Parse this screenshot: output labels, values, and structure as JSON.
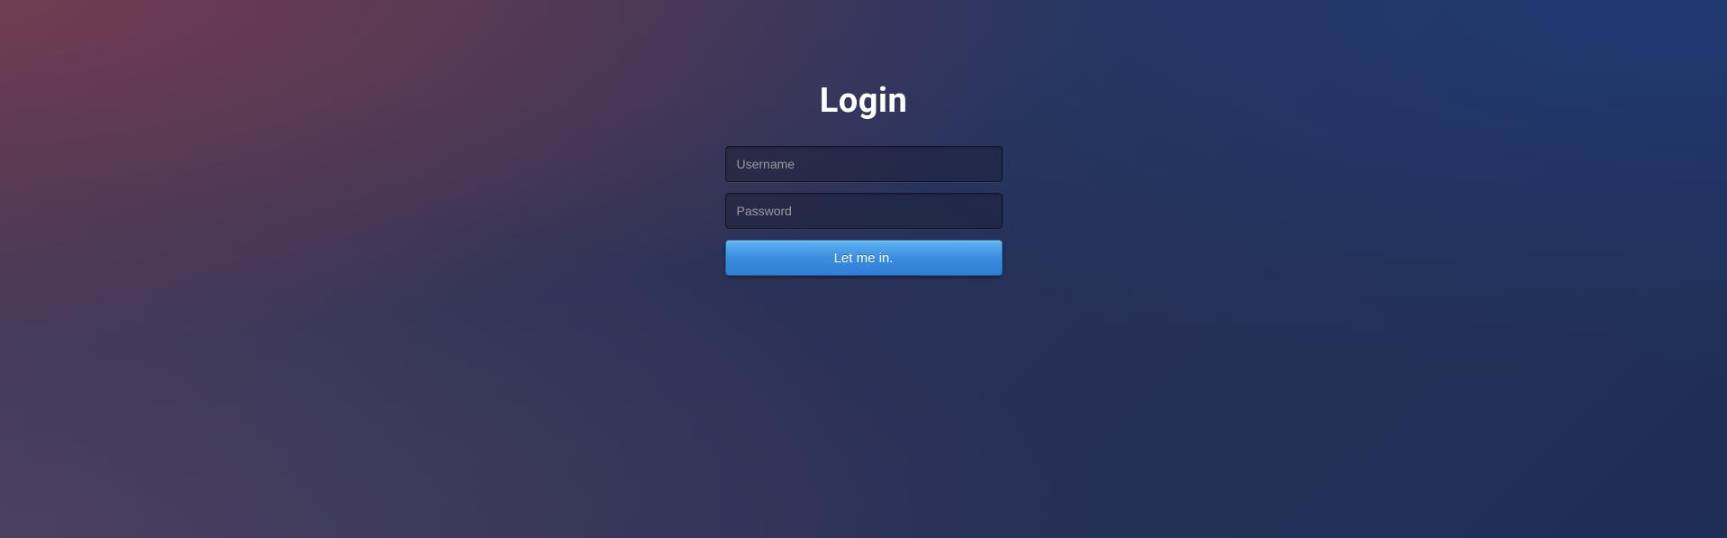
{
  "login": {
    "title": "Login",
    "username": {
      "placeholder": "Username",
      "value": ""
    },
    "password": {
      "placeholder": "Password",
      "value": ""
    },
    "submit_label": "Let me in."
  }
}
